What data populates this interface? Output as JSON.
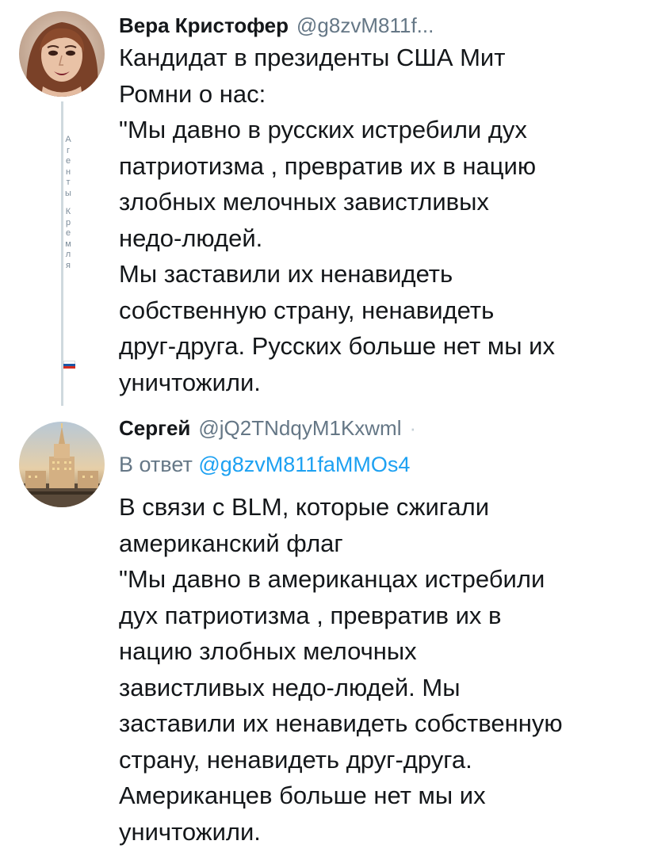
{
  "tweets": [
    {
      "name": "Вера Кристофер",
      "handle": "@g8zvM811f...",
      "text": "Кандидат в президенты США Мит\nРомни о нас:\n\"Мы давно в русских истребили дух\nпатриотизма , превратив их в нацию\nзлобных мелочных завистливых\nнедо-людей.\nМы заставили их ненавидеть\nсобственную страну, ненавидеть\nдруг-друга. Русских больше нет мы их\nуничтожили.",
      "avatar_icon": "woman-portrait-avatar",
      "side_text": [
        "А",
        "г",
        "е",
        "н",
        "т",
        "ы",
        "",
        "К",
        "р",
        "е",
        "м",
        "л",
        "я"
      ]
    },
    {
      "name": "Сергей",
      "handle": "@jQ2TNdqyM1Kxwml",
      "separator": "·",
      "reply_prefix": "В ответ",
      "reply_mention": "@g8zvM811faMMOs4",
      "text": "В связи с BLM, которые сжигали\nамериканский флаг\n\"Мы давно в американцах истребили\nдух патриотизма , превратив их в\nнацию злобных мелочных\nзавистливых недо-людей. Мы\nзаставили их ненавидеть собственную\nстрану, ненавидеть друг-друга.\nАмериканцев больше нет мы их\nуничтожили.",
      "avatar_icon": "moscow-university-avatar"
    }
  ],
  "colors": {
    "text": "#14171a",
    "secondary": "#657786",
    "link": "#1da1f2",
    "thread_line": "#cfd9de"
  }
}
